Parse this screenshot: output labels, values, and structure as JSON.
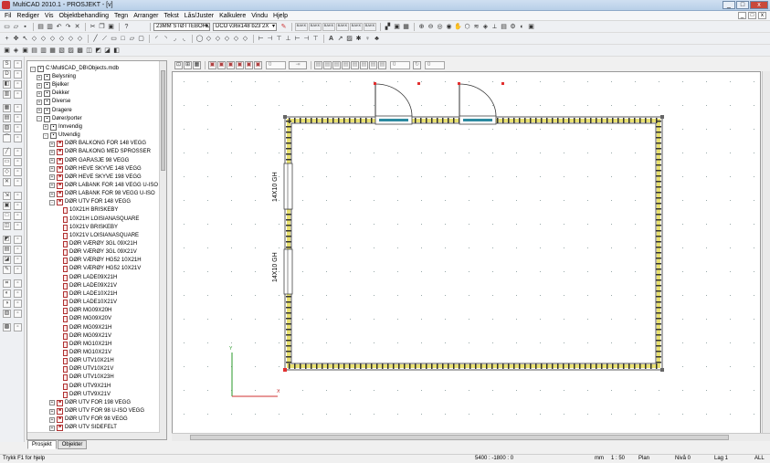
{
  "window": {
    "title": "MultiCAD 2010.1 - PROSJEKT - [v]",
    "controls": [
      "_",
      "□",
      "x"
    ],
    "mdi_controls": [
      "_",
      "□",
      "x"
    ]
  },
  "menu": [
    "Fil",
    "Rediger",
    "Vis",
    "Objektbehandling",
    "Tegn",
    "Arranger",
    "Tekst",
    "Lås/Juster",
    "Kalkulere",
    "Vindu",
    "Hjelp"
  ],
  "toolbar": {
    "wall_combo": "23MM STØTTEBORD",
    "dco_combo": "DCO v36x148 b23 2X",
    "mini_labels": [
      "BAKK",
      "BAKK",
      "BAKK",
      "BAKK",
      "BAKK",
      "BAKK"
    ]
  },
  "draw_toolbar": {
    "field1": "0",
    "field2": "0",
    "field3": "0"
  },
  "tree": {
    "root": "C:\\MultiCAD_DB\\Objects.mdb",
    "items": [
      {
        "label": "Belysning",
        "indent": 1,
        "type": "folder",
        "exp": "+"
      },
      {
        "label": "Bjelker",
        "indent": 1,
        "type": "folder",
        "exp": "+"
      },
      {
        "label": "Dekker",
        "indent": 1,
        "type": "folder",
        "exp": "+"
      },
      {
        "label": "Diverse",
        "indent": 1,
        "type": "folder",
        "exp": "+"
      },
      {
        "label": "Dragere",
        "indent": 1,
        "type": "folder",
        "exp": "+"
      },
      {
        "label": "Dører/porter",
        "indent": 1,
        "type": "folder",
        "exp": "-"
      },
      {
        "label": "Innvendig",
        "indent": 2,
        "type": "folder",
        "exp": "+"
      },
      {
        "label": "Utvendig",
        "indent": 2,
        "type": "folder",
        "exp": "-"
      },
      {
        "label": "DØR BALKONG FOR 148 VEGG",
        "indent": 3,
        "type": "door",
        "exp": "+"
      },
      {
        "label": "DØR BALKONG MED SPROSSER",
        "indent": 3,
        "type": "door",
        "exp": "+"
      },
      {
        "label": "DØR GARASJE 98 VEGG",
        "indent": 3,
        "type": "door",
        "exp": "+"
      },
      {
        "label": "DØR HEVE SKYVE 148 VEGG",
        "indent": 3,
        "type": "door",
        "exp": "+"
      },
      {
        "label": "DØR HEVE SKYVE 198 VEGG",
        "indent": 3,
        "type": "door",
        "exp": "+"
      },
      {
        "label": "DØR LABANK FOR 148 VEGG U-ISO",
        "indent": 3,
        "type": "door",
        "exp": "+"
      },
      {
        "label": "DØR LABANK FOR 98 VEGG U-ISO",
        "indent": 3,
        "type": "door",
        "exp": "+"
      },
      {
        "label": "DØR UTV FOR 148 VEGG",
        "indent": 3,
        "type": "door",
        "exp": "-"
      },
      {
        "label": "10X21H BRISKEBY",
        "indent": 4,
        "type": "leaf"
      },
      {
        "label": "10X21H LOISIANASQUARE",
        "indent": 4,
        "type": "leaf"
      },
      {
        "label": "10X21V BRISKEBY",
        "indent": 4,
        "type": "leaf"
      },
      {
        "label": "10X21V LOISIANASQUARE",
        "indent": 4,
        "type": "leaf"
      },
      {
        "label": "DØR  VÆRØY 3GL 09X21H",
        "indent": 4,
        "type": "leaf"
      },
      {
        "label": "DØR  VÆRØY 3GL 09X21V",
        "indent": 4,
        "type": "leaf"
      },
      {
        "label": "DØR  VÆRØY HG52 10X21H",
        "indent": 4,
        "type": "leaf"
      },
      {
        "label": "DØR  VÆRØY HG52 10X21V",
        "indent": 4,
        "type": "leaf"
      },
      {
        "label": "DØR LADE09X21H",
        "indent": 4,
        "type": "leaf"
      },
      {
        "label": "DØR LADE09X21V",
        "indent": 4,
        "type": "leaf"
      },
      {
        "label": "DØR LADE10X21H",
        "indent": 4,
        "type": "leaf"
      },
      {
        "label": "DØR LADE10X21V",
        "indent": 4,
        "type": "leaf"
      },
      {
        "label": "DØR MG09X20H",
        "indent": 4,
        "type": "leaf"
      },
      {
        "label": "DØR MG09X20V",
        "indent": 4,
        "type": "leaf"
      },
      {
        "label": "DØR MG09X21H",
        "indent": 4,
        "type": "leaf"
      },
      {
        "label": "DØR MG09X21V",
        "indent": 4,
        "type": "leaf"
      },
      {
        "label": "DØR MG10X21H",
        "indent": 4,
        "type": "leaf"
      },
      {
        "label": "DØR MG10X21V",
        "indent": 4,
        "type": "leaf"
      },
      {
        "label": "DØR UTV10X21H",
        "indent": 4,
        "type": "leaf"
      },
      {
        "label": "DØR UTV10X21V",
        "indent": 4,
        "type": "leaf"
      },
      {
        "label": "DØR UTV10X23H",
        "indent": 4,
        "type": "leaf"
      },
      {
        "label": "DØR UTV9X21H",
        "indent": 4,
        "type": "leaf"
      },
      {
        "label": "DØR UTV9X21V",
        "indent": 4,
        "type": "leaf"
      },
      {
        "label": "DØR UTV FOR 198 VEGG",
        "indent": 3,
        "type": "door",
        "exp": "+"
      },
      {
        "label": "DØR UTV FOR 98 U-ISO VEGG",
        "indent": 3,
        "type": "door",
        "exp": "+"
      },
      {
        "label": "DØR UTV FOR 98 VEGG",
        "indent": 3,
        "type": "door",
        "exp": "+"
      },
      {
        "label": "DØR UTV SIDEFELT",
        "indent": 3,
        "type": "door",
        "exp": "+"
      }
    ]
  },
  "tabs": [
    "Prosjekt",
    "Objekter"
  ],
  "drawing": {
    "label_upper": "14X10 GH",
    "label_lower": "14X10 GH",
    "axis_y": "Y",
    "axis_x": "X",
    "wall_color": "#5a5a5a",
    "insulation_color": "#e8e070",
    "handle_color": "#e23030",
    "axis_y_color": "#2a9a2a",
    "axis_x_color": "#d23030"
  },
  "status": {
    "help": "Trykk F1 for hjelp",
    "coords": "5400 : -1800 : 0",
    "unit": "mm",
    "scale": "1 : 50",
    "view": "Plan",
    "level": "Nivå 0",
    "layer": "Lag 1",
    "filter": "ALL"
  }
}
